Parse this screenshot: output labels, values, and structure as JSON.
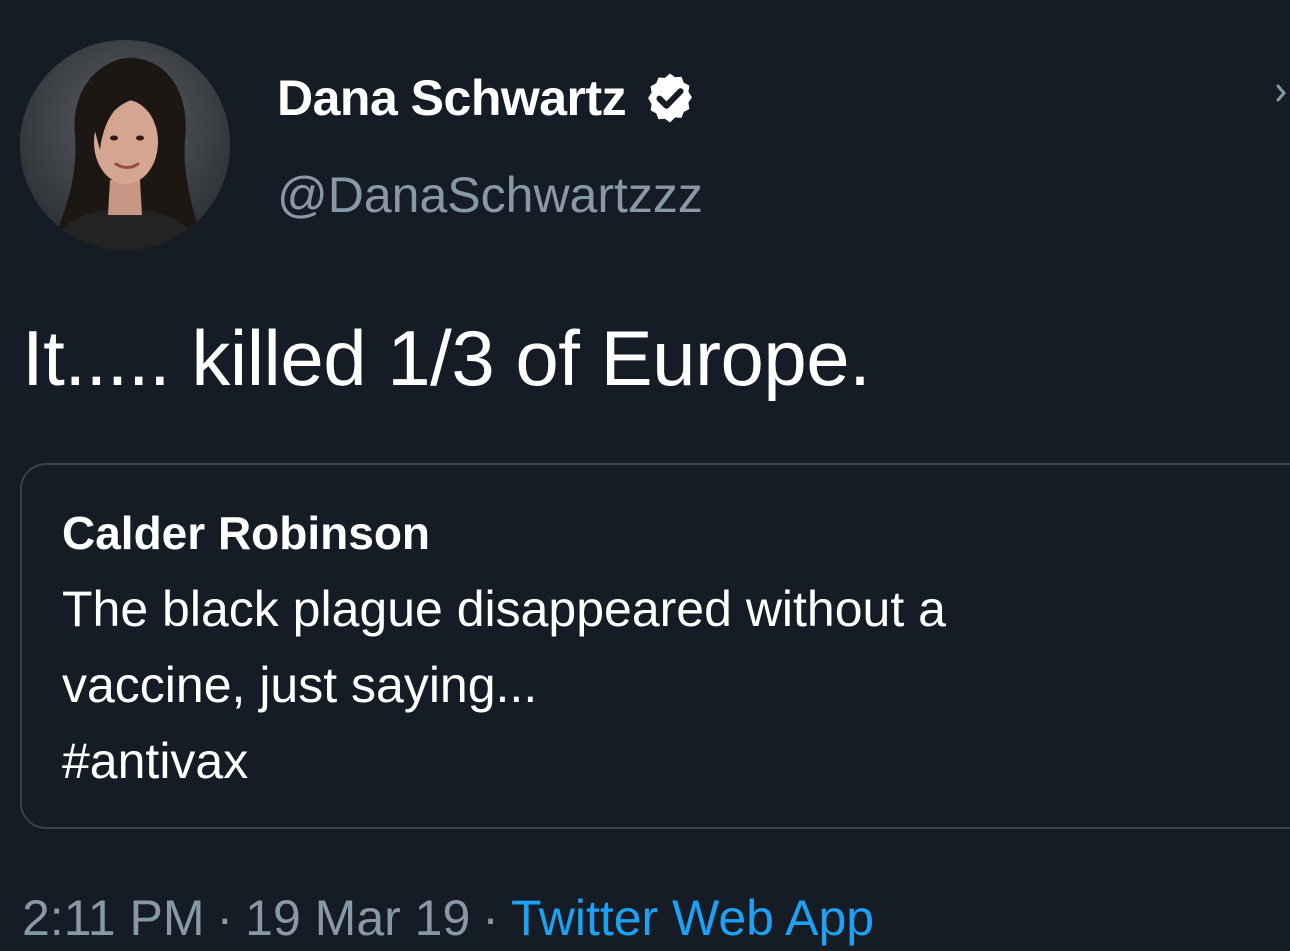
{
  "author": {
    "display_name": "Dana Schwartz",
    "handle": "@DanaSchwartzzz",
    "verified": true,
    "avatar_icon": "profile-photo-avatar"
  },
  "tweet": {
    "text": "It..... killed 1/3 of Europe."
  },
  "quoted_tweet": {
    "author": "Calder Robinson",
    "lines": [
      "The black plague disappeared without a",
      "vaccine, just saying...",
      "#antivax"
    ]
  },
  "meta": {
    "time": "2:11 PM",
    "separator": "·",
    "date": "19 Mar 19",
    "source": "Twitter Web App"
  },
  "colors": {
    "background": "#161c26",
    "secondary_text": "#8899a6",
    "link": "#1da1f2",
    "border": "#38444d"
  },
  "icons": {
    "verified": "verified-badge-icon",
    "more": "chevron-down-icon"
  }
}
